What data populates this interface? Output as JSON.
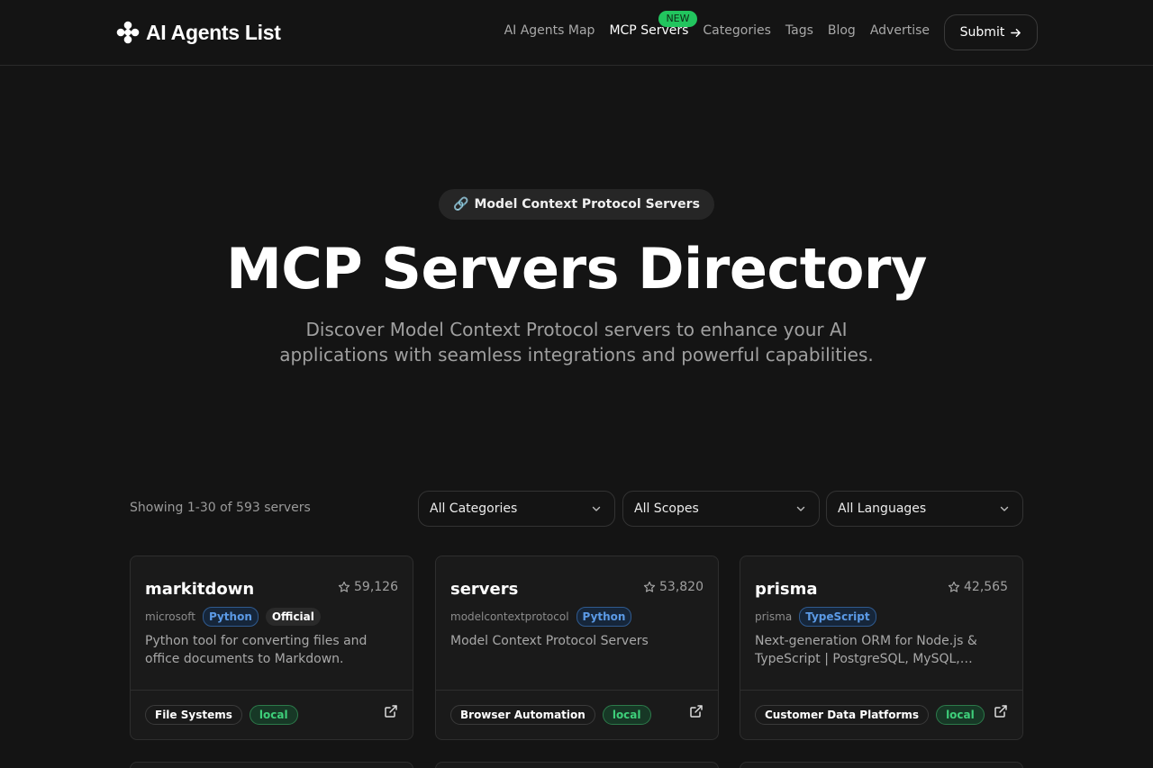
{
  "header": {
    "brand": "AI Agents List",
    "nav": [
      {
        "label": "AI Agents Map"
      },
      {
        "label": "MCP Servers",
        "badge": "NEW",
        "active": true
      },
      {
        "label": "Categories"
      },
      {
        "label": "Tags"
      },
      {
        "label": "Blog"
      },
      {
        "label": "Advertise"
      }
    ],
    "submit_label": "Submit"
  },
  "hero": {
    "pill_icon": "🔗",
    "pill_label": "Model Context Protocol Servers",
    "title": "MCP Servers Directory",
    "subtitle": "Discover Model Context Protocol servers to enhance your AI applications with seamless integrations and powerful capabilities."
  },
  "filters": {
    "showing": "Showing 1-30 of 593 servers",
    "category": "All Categories",
    "scope": "All Scopes",
    "language": "All Languages"
  },
  "cards": [
    {
      "name": "markitdown",
      "stars": "59,126",
      "owner": "microsoft",
      "language": "Python",
      "official": "Official",
      "description": "Python tool for converting files and office documents to Markdown.",
      "category": "File Systems",
      "scope": "local"
    },
    {
      "name": "servers",
      "stars": "53,820",
      "owner": "modelcontextprotocol",
      "language": "Python",
      "description": "Model Context Protocol Servers",
      "category": "Browser Automation",
      "scope": "local"
    },
    {
      "name": "prisma",
      "stars": "42,565",
      "owner": "prisma",
      "language": "TypeScript",
      "description": "Next-generation ORM for Node.js & TypeScript | PostgreSQL, MySQL,…",
      "category": "Customer Data Platforms",
      "scope": "local"
    }
  ],
  "colors": {
    "background": "#141414",
    "card": "#1a1a1a",
    "accent_green": "#22c55e",
    "language_blue": "#5b9ae6"
  }
}
